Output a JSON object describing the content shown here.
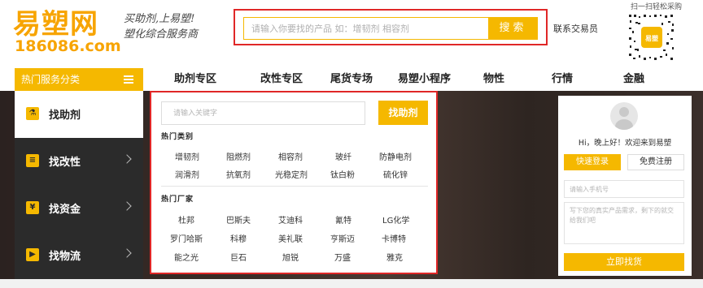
{
  "header": {
    "logo_cn": "易塑网",
    "logo_url": "186086.com",
    "slogan_line1": "买助剂,上易塑!",
    "slogan_line2": "塑化综合服务商",
    "search_placeholder": "请输入你要找的产品 如：增韧剂 相容剂",
    "search_button": "搜索",
    "contact_link": "联系交易员",
    "qr_caption": "扫一扫轻松采购"
  },
  "nav": {
    "category_label": "热门服务分类",
    "items": [
      "助剂专区",
      "改性专区",
      "尾货专场",
      "易塑小程序",
      "物性",
      "行情",
      "金融"
    ]
  },
  "sidebar": {
    "items": [
      {
        "label": "找助剂",
        "icon": "flask-icon"
      },
      {
        "label": "找改性",
        "icon": "document-icon"
      },
      {
        "label": "找资金",
        "icon": "money-bag-icon"
      },
      {
        "label": "找物流",
        "icon": "truck-icon"
      }
    ]
  },
  "panel": {
    "keyword_placeholder": "请输入关键字",
    "find_button": "找助剂",
    "hot_categories_title": "热门类别",
    "hot_categories": [
      "增韧剂",
      "阻燃剂",
      "相容剂",
      "玻纤",
      "防静电剂",
      "润滑剂",
      "抗氧剂",
      "光稳定剂",
      "钛白粉",
      "硫化锌"
    ],
    "hot_vendors_title": "热门厂家",
    "hot_vendors": [
      "杜邦",
      "巴斯夫",
      "艾迪科",
      "氰特",
      "LG化学",
      "罗门哈斯",
      "科穆",
      "美礼联",
      "亨斯迈",
      "卡博特",
      "能之光",
      "巨石",
      "旭锐",
      "万盛",
      "雅克"
    ]
  },
  "login": {
    "greeting": "Hi，晚上好！欢迎来到易塑",
    "login_button": "快速登录",
    "register_button": "免费注册",
    "phone_placeholder": "请输入手机号",
    "demand_placeholder": "写下您的真实产品需求，剩下的就交给我们吧",
    "submit_button": "立即找货"
  },
  "colors": {
    "accent": "#f5b800",
    "highlight_border": "#e02727",
    "sidebar_bg": "#2b2b2b"
  }
}
